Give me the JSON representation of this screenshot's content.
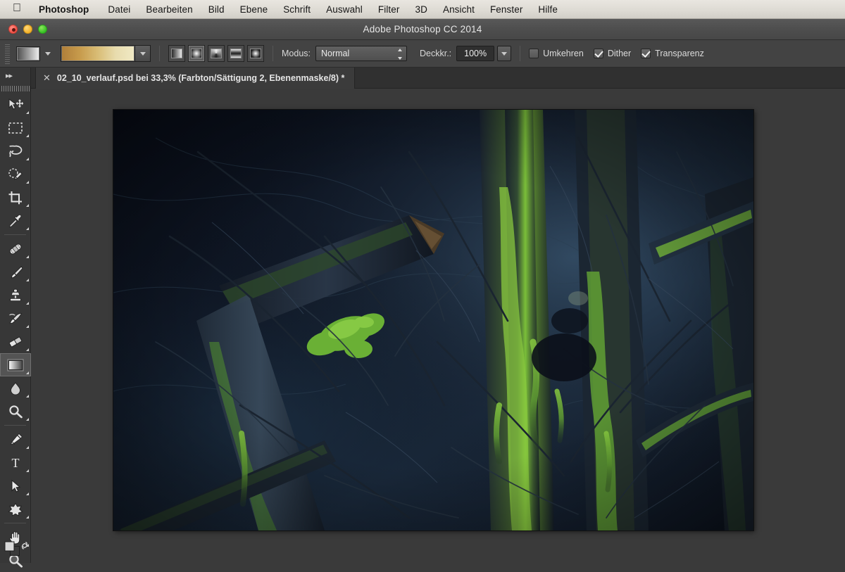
{
  "menubar": {
    "apple_icon": "apple-logo-icon",
    "items": [
      {
        "label": "Photoshop",
        "bold": true
      },
      {
        "label": "Datei",
        "bold": false
      },
      {
        "label": "Bearbeiten",
        "bold": false
      },
      {
        "label": "Bild",
        "bold": false
      },
      {
        "label": "Ebene",
        "bold": false
      },
      {
        "label": "Schrift",
        "bold": false
      },
      {
        "label": "Auswahl",
        "bold": false
      },
      {
        "label": "Filter",
        "bold": false
      },
      {
        "label": "3D",
        "bold": false
      },
      {
        "label": "Ansicht",
        "bold": false
      },
      {
        "label": "Fenster",
        "bold": false
      },
      {
        "label": "Hilfe",
        "bold": false
      }
    ]
  },
  "window": {
    "title": "Adobe Photoshop CC 2014",
    "controls": {
      "close": "close-button",
      "minimize": "minimize-button",
      "zoom": "zoom-button"
    }
  },
  "options_bar": {
    "gradient_preset_icon": "gradient-preset-icon",
    "gradient_preset_caret": "chevron-down-icon",
    "gradient_swatch": {
      "name": "gradient-swatch",
      "stops": [
        "#b07f3a",
        "#c79b4c",
        "#d9bd76",
        "#e8dcae",
        "#f0e9c4"
      ]
    },
    "gradient_types": [
      {
        "name": "linear-gradient-button",
        "label": "Linearer Verlauf",
        "selected": false
      },
      {
        "name": "radial-gradient-button",
        "label": "Radialer Verlauf",
        "selected": true
      },
      {
        "name": "angle-gradient-button",
        "label": "Winkelverlauf",
        "selected": false
      },
      {
        "name": "reflected-gradient-button",
        "label": "Gespiegelter Verlauf",
        "selected": false
      },
      {
        "name": "diamond-gradient-button",
        "label": "Rautenverlauf",
        "selected": false
      }
    ],
    "mode_label": "Modus:",
    "mode_value": "Normal",
    "opacity_label": "Deckkr.:",
    "opacity_value": "100%",
    "checkboxes": [
      {
        "label": "Umkehren",
        "checked": false
      },
      {
        "label": "Dither",
        "checked": true
      },
      {
        "label": "Transparenz",
        "checked": true
      }
    ]
  },
  "tab": {
    "close_icon": "close-icon",
    "title": "02_10_verlauf.psd bei 33,3% (Farbton/Sättigung 2, Ebenenmaske/8) *"
  },
  "tools": {
    "collapse_icon": "double-chevron-right-icon",
    "items": [
      {
        "name": "move-tool",
        "icon": "move-icon",
        "selected": false,
        "corner": true
      },
      {
        "name": "rectangular-marquee-tool",
        "icon": "marquee-icon",
        "selected": false,
        "corner": true
      },
      {
        "name": "lasso-tool",
        "icon": "lasso-icon",
        "selected": false,
        "corner": true
      },
      {
        "name": "quick-selection-tool",
        "icon": "quick-selection-icon",
        "selected": false,
        "corner": true
      },
      {
        "name": "crop-tool",
        "icon": "crop-icon",
        "selected": false,
        "corner": true
      },
      {
        "name": "eyedropper-tool",
        "icon": "eyedropper-icon",
        "selected": false,
        "corner": true
      },
      {
        "name": "healing-brush-tool",
        "icon": "bandage-icon",
        "selected": false,
        "corner": true
      },
      {
        "name": "brush-tool",
        "icon": "brush-icon",
        "selected": false,
        "corner": true
      },
      {
        "name": "clone-stamp-tool",
        "icon": "stamp-icon",
        "selected": false,
        "corner": true
      },
      {
        "name": "history-brush-tool",
        "icon": "history-brush-icon",
        "selected": false,
        "corner": true
      },
      {
        "name": "eraser-tool",
        "icon": "eraser-icon",
        "selected": false,
        "corner": true
      },
      {
        "name": "gradient-tool",
        "icon": "gradient-icon",
        "selected": true,
        "corner": true
      },
      {
        "name": "blur-tool",
        "icon": "blur-drop-icon",
        "selected": false,
        "corner": true
      },
      {
        "name": "dodge-tool",
        "icon": "dodge-icon",
        "selected": false,
        "corner": true
      },
      {
        "name": "pen-tool",
        "icon": "pen-nib-icon",
        "selected": false,
        "corner": true
      },
      {
        "name": "type-tool",
        "icon": "type-t-icon",
        "selected": false,
        "corner": true
      },
      {
        "name": "path-selection-tool",
        "icon": "arrow-cursor-icon",
        "selected": false,
        "corner": true
      },
      {
        "name": "shape-tool",
        "icon": "custom-shape-icon",
        "selected": false,
        "corner": true
      },
      {
        "name": "hand-tool",
        "icon": "hand-icon",
        "selected": false,
        "corner": true
      },
      {
        "name": "zoom-tool",
        "icon": "magnifier-icon",
        "selected": false,
        "corner": false
      }
    ],
    "color_swatches": {
      "name": "foreground-background-color",
      "foreground": "#d8d8d8",
      "background": "#3a3a3a",
      "swap_icon": "swap-colors-icon"
    }
  },
  "document": {
    "name": "document-canvas",
    "zoom": "33,3%",
    "image_description": "Dunkler Waldausschnitt: moosbewachsene Baumstämme und Äste in Blau- und Grüntönen",
    "palette": {
      "deep_navy": "#0a101c",
      "mid_blue": "#1d2b3d",
      "slate_blue": "#33485c",
      "moss_green": "#7cc23a",
      "dark_bark": "#171c23",
      "highlight": "#8fa5b4"
    }
  }
}
